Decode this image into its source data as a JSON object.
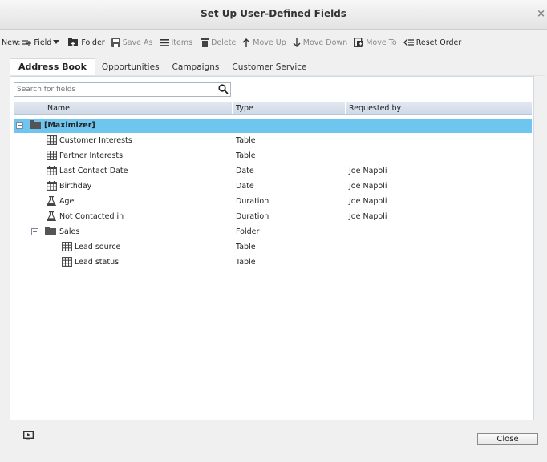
{
  "window": {
    "title": "Set Up User-Defined Fields",
    "close_glyph": "×"
  },
  "toolbar": {
    "new_label": "New:",
    "field_label": "Field",
    "folder_label": "Folder",
    "save_as_label": "Save As",
    "items_label": "Items",
    "delete_label": "Delete",
    "move_up_label": "Move Up",
    "move_down_label": "Move Down",
    "move_to_label": "Move To",
    "reset_order_label": "Reset Order"
  },
  "tabs": [
    "Address Book",
    "Opportunities",
    "Campaigns",
    "Customer Service"
  ],
  "search": {
    "placeholder": "Search for fields"
  },
  "columns": {
    "name": "Name",
    "type": "Type",
    "requested_by": "Requested by"
  },
  "rows": [
    {
      "name": "[Maximizer]",
      "type": "",
      "requested_by": "",
      "icon": "folder-icon",
      "expander": "minus"
    },
    {
      "name": "Customer Interests",
      "type": "Table",
      "requested_by": "",
      "icon": "table-icon"
    },
    {
      "name": "Partner Interests",
      "type": "Table",
      "requested_by": "",
      "icon": "table-icon"
    },
    {
      "name": "Last Contact Date",
      "type": "Date",
      "requested_by": "Joe Napoli",
      "icon": "calendar-icon"
    },
    {
      "name": "Birthday",
      "type": "Date",
      "requested_by": "Joe Napoli",
      "icon": "calendar-icon"
    },
    {
      "name": "Age",
      "type": "Duration",
      "requested_by": "Joe Napoli",
      "icon": "flask-icon"
    },
    {
      "name": "Not Contacted in",
      "type": "Duration",
      "requested_by": "Joe Napoli",
      "icon": "flask-icon"
    },
    {
      "name": "Sales",
      "type": "Folder",
      "requested_by": "",
      "icon": "folder-icon",
      "expander": "minus"
    },
    {
      "name": "Lead source",
      "type": "Table",
      "requested_by": "",
      "icon": "table-icon"
    },
    {
      "name": "Lead status",
      "type": "Table",
      "requested_by": "",
      "icon": "table-icon"
    }
  ],
  "footer": {
    "close_label": "Close",
    "slideshow_icon": "slideshow-icon"
  },
  "colors": {
    "selected_row": "#6ec6f0",
    "header_bg": "#cfd9e6"
  }
}
